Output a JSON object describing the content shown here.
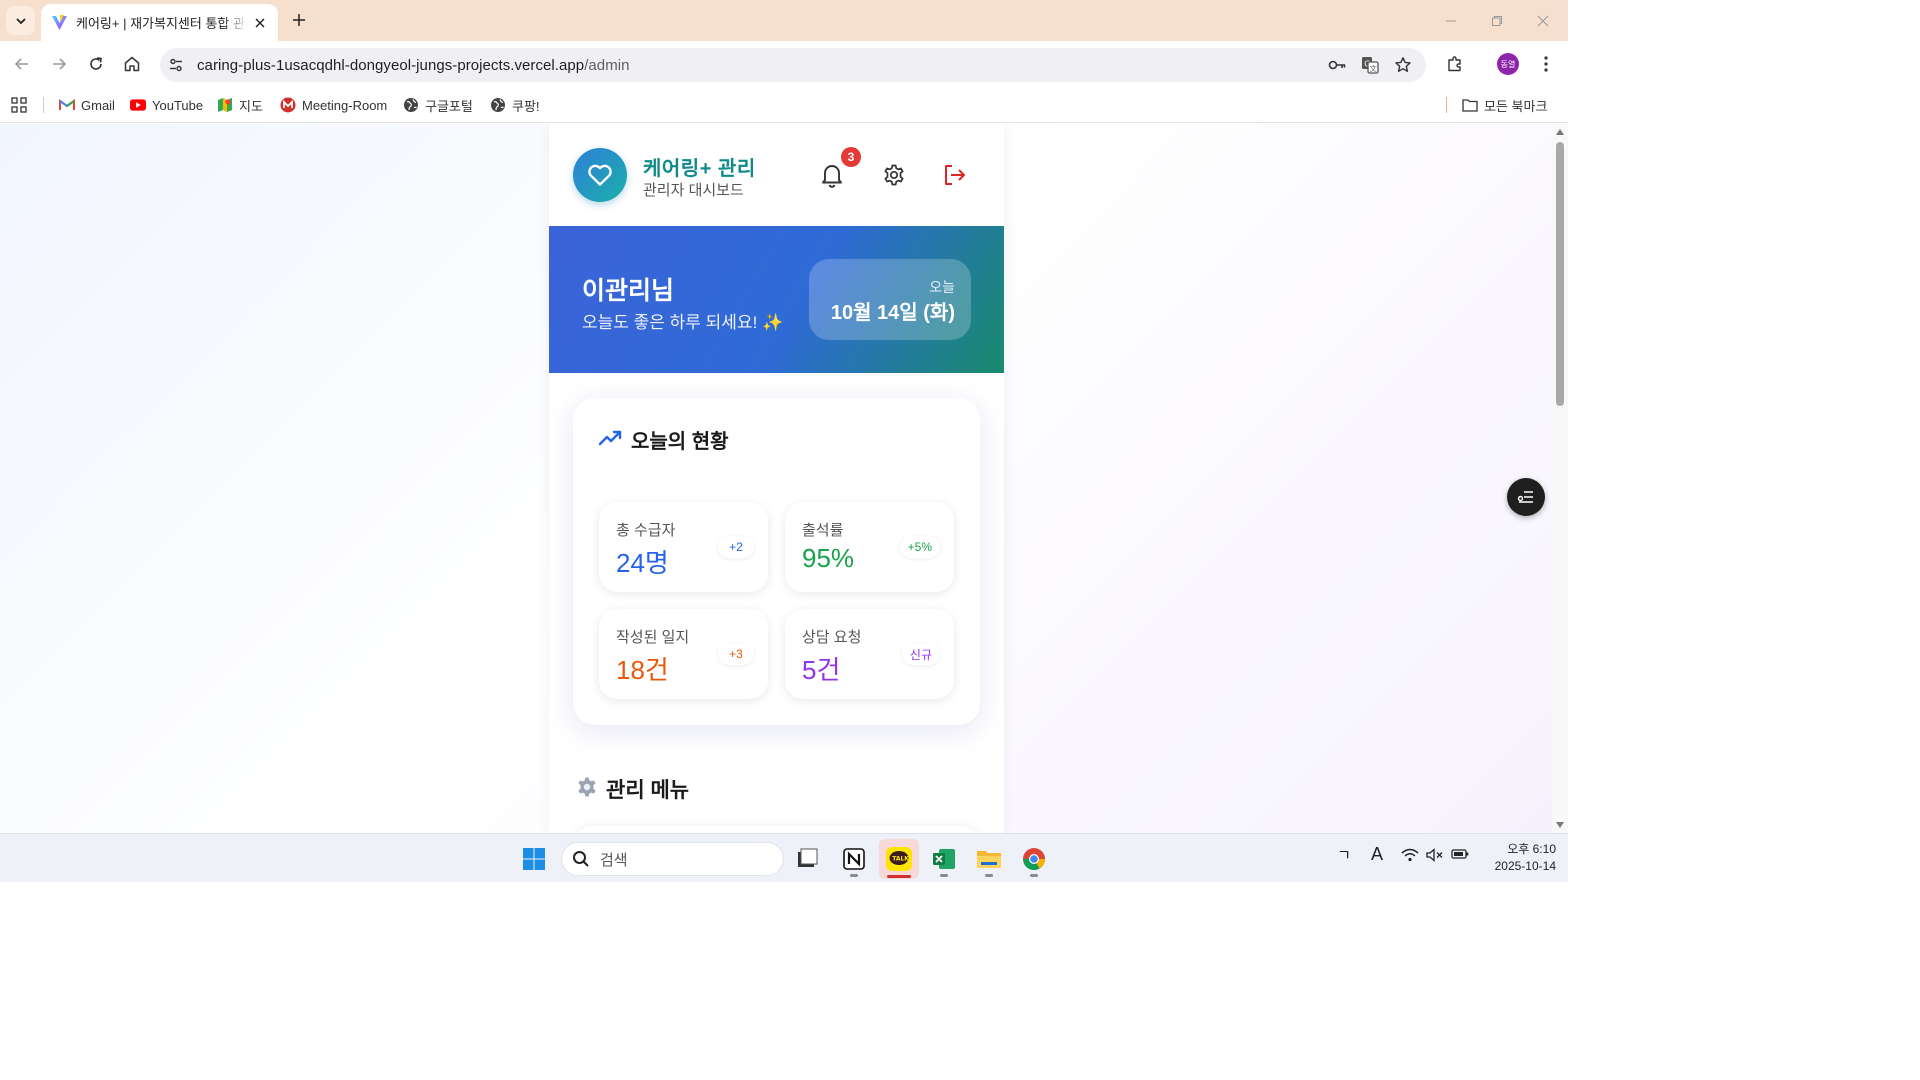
{
  "browser": {
    "tab_title": "케어링+ | 재가복지센터 통합 관리",
    "url_host": "caring-plus-1usacqdhl-dongyeol-jungs-projects.vercel.app",
    "url_path": "/admin",
    "profile_initials": "동열",
    "bookmarks": [
      {
        "label": "Gmail",
        "icon": "gmail-icon"
      },
      {
        "label": "YouTube",
        "icon": "youtube-icon"
      },
      {
        "label": "지도",
        "icon": "maps-icon"
      },
      {
        "label": "Meeting-Room",
        "icon": "meeting-room-icon"
      },
      {
        "label": "구글포털",
        "icon": "globe-icon"
      },
      {
        "label": "쿠팡!",
        "icon": "globe-icon"
      }
    ],
    "all_bookmarks_label": "모든 북마크"
  },
  "app": {
    "brand": "케어링+ 관리",
    "subtitle": "관리자 대시보드",
    "notification_count": "3",
    "brand_color": "#0f8a8a"
  },
  "hero": {
    "name": "이관리님",
    "greeting": "오늘도 좋은 하루 되세요! ✨",
    "date_label": "오늘",
    "date_value": "10월 14일 (화)"
  },
  "status": {
    "title": "오늘의 현황",
    "stats": [
      {
        "label": "총 수급자",
        "value": "24명",
        "change": "+2",
        "color": "#2563eb"
      },
      {
        "label": "출석률",
        "value": "95%",
        "change": "+5%",
        "color": "#16a34a"
      },
      {
        "label": "작성된 일지",
        "value": "18건",
        "change": "+3",
        "color": "#ea580c"
      },
      {
        "label": "상담 요청",
        "value": "5건",
        "change": "신규",
        "color": "#9333ea"
      }
    ]
  },
  "menu": {
    "title": "관리 메뉴"
  },
  "taskbar": {
    "search_placeholder": "검색",
    "ime_label_1": "ㄱ",
    "ime_label_2": "A",
    "clock_time": "오후 6:10",
    "clock_date": "2025-10-14"
  }
}
